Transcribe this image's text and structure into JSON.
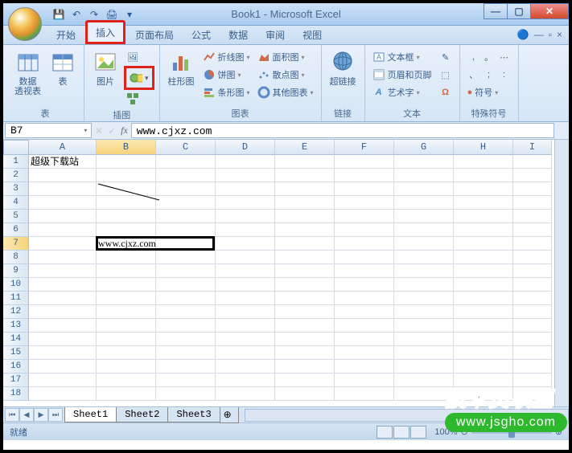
{
  "title": "Book1 - Microsoft Excel",
  "tabs": [
    "开始",
    "插入",
    "页面布局",
    "公式",
    "数据",
    "审阅",
    "视图"
  ],
  "active_tab": "插入",
  "ribbon": {
    "groups": {
      "tables": {
        "label": "表",
        "pivot_label": "数据\n透视表",
        "table_label": "表"
      },
      "illustrations": {
        "label": "插图",
        "picture_label": "图片"
      },
      "charts": {
        "label": "图表",
        "column_label": "柱形图",
        "line": "折线图",
        "pie": "饼图",
        "bar": "条形图",
        "area": "面积图",
        "scatter": "散点图",
        "other": "其他图表"
      },
      "links": {
        "label": "链接",
        "hyperlink_label": "超链接"
      },
      "text": {
        "label": "文本",
        "textbox": "文本框",
        "headerfooter": "页眉和页脚",
        "wordart": "艺术字"
      },
      "symbols": {
        "label": "特殊符号",
        "symbol": "符号"
      }
    }
  },
  "name_box": "B7",
  "formula": "www.cjxz.com",
  "columns": [
    "A",
    "B",
    "C",
    "D",
    "E",
    "F",
    "G",
    "H",
    "I"
  ],
  "cells": {
    "A1": "超级下载站",
    "B7": "www.cjxz.com"
  },
  "sheet_tabs": [
    "Sheet1",
    "Sheet2",
    "Sheet3"
  ],
  "active_sheet": "Sheet1",
  "status": "就绪",
  "zoom": "100%",
  "watermark": {
    "top": "技术员联盟",
    "bottom": "www.jsgho.com"
  }
}
